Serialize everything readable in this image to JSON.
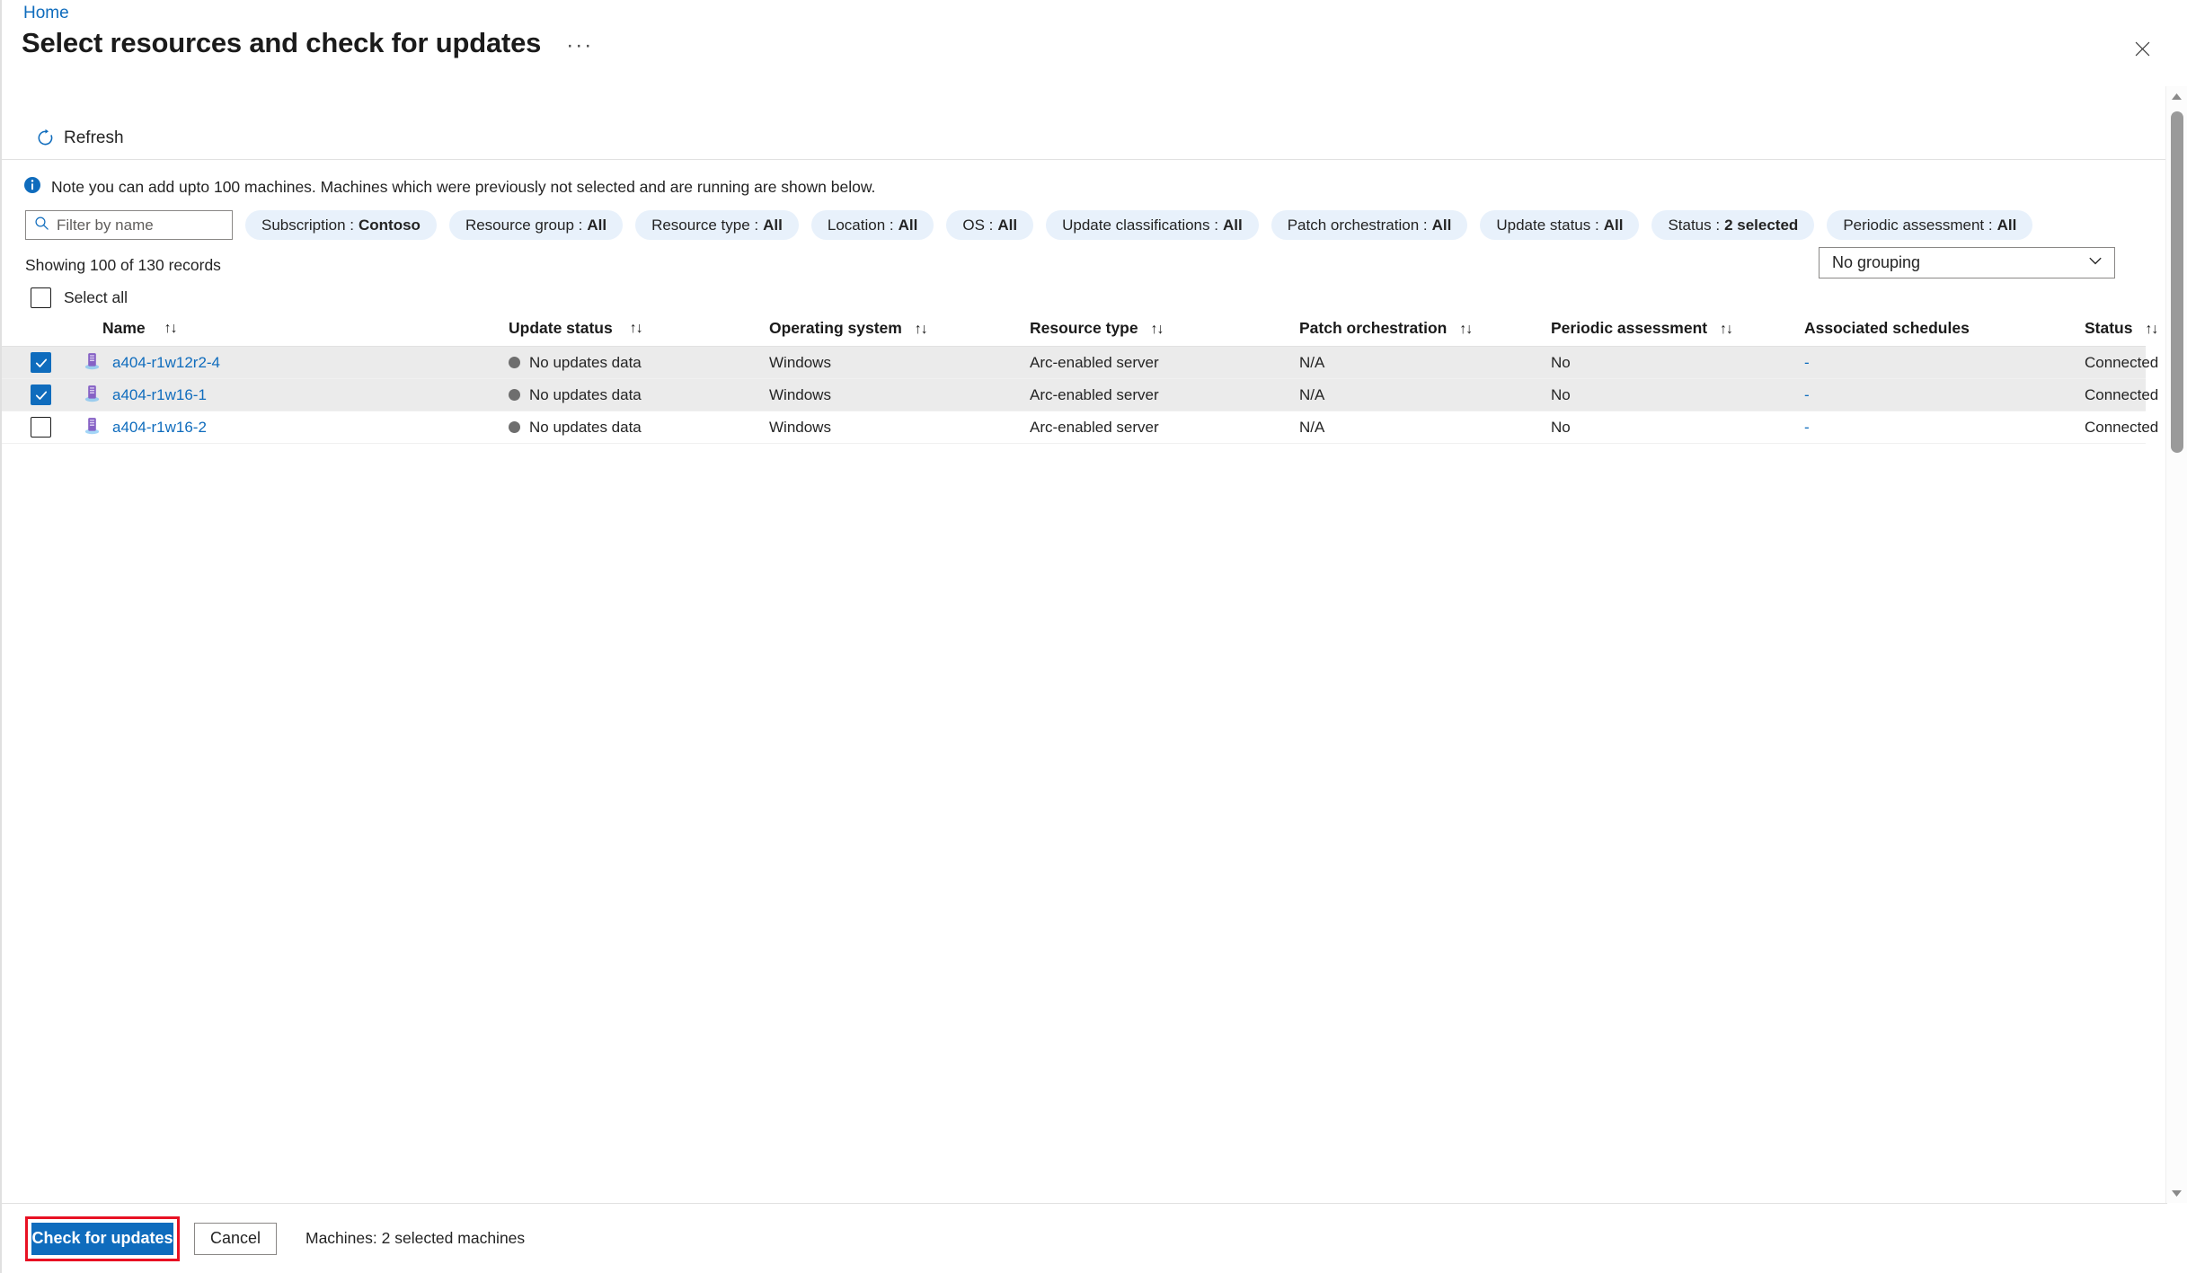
{
  "breadcrumb": {
    "home": "Home"
  },
  "header": {
    "title": "Select resources and check for updates",
    "ellipsis": "···",
    "close_icon": "close-icon"
  },
  "commandbar": {
    "refresh_label": "Refresh",
    "refresh_icon": "refresh-icon"
  },
  "info": {
    "icon": "info-icon",
    "text": "Note you can add upto 100 machines. Machines which were previously not selected and are running are shown below."
  },
  "search": {
    "placeholder": "Filter by name",
    "value": "",
    "icon": "search-icon"
  },
  "filters": [
    {
      "label": "Subscription :",
      "value": "Contoso"
    },
    {
      "label": "Resource group :",
      "value": "All"
    },
    {
      "label": "Resource type :",
      "value": "All"
    },
    {
      "label": "Location :",
      "value": "All"
    },
    {
      "label": "OS :",
      "value": "All"
    },
    {
      "label": "Update classifications :",
      "value": "All"
    },
    {
      "label": "Patch orchestration :",
      "value": "All"
    },
    {
      "label": "Update status :",
      "value": "All"
    },
    {
      "label": "Status :",
      "value": "2 selected"
    },
    {
      "label": "Periodic assessment :",
      "value": "All"
    }
  ],
  "records": {
    "showing_text": "Showing 100 of 130 records"
  },
  "grouping": {
    "selected": "No grouping",
    "chevron_icon": "chevron-down-icon"
  },
  "select_all": {
    "label": "Select all",
    "checked": false
  },
  "table": {
    "columns": [
      {
        "key": "name",
        "label": "Name",
        "sortable": true
      },
      {
        "key": "update_status",
        "label": "Update status",
        "sortable": true
      },
      {
        "key": "operating_system",
        "label": "Operating system",
        "sortable": true
      },
      {
        "key": "resource_type",
        "label": "Resource type",
        "sortable": true
      },
      {
        "key": "patch_orchestration",
        "label": "Patch orchestration",
        "sortable": true
      },
      {
        "key": "periodic_assessment",
        "label": "Periodic assessment",
        "sortable": true
      },
      {
        "key": "associated_schedules",
        "label": "Associated schedules",
        "sortable": false
      },
      {
        "key": "status",
        "label": "Status",
        "sortable": true
      }
    ],
    "sort_glyph": "↑↓",
    "rows": [
      {
        "checked": true,
        "icon": "machine-icon",
        "name": "a404-r1w12r2-4",
        "update_status": "No updates data",
        "operating_system": "Windows",
        "resource_type": "Arc-enabled server",
        "patch_orchestration": "N/A",
        "periodic_assessment": "No",
        "associated_schedules": "-",
        "status": "Connected"
      },
      {
        "checked": true,
        "icon": "machine-icon",
        "name": "a404-r1w16-1",
        "update_status": "No updates data",
        "operating_system": "Windows",
        "resource_type": "Arc-enabled server",
        "patch_orchestration": "N/A",
        "periodic_assessment": "No",
        "associated_schedules": "-",
        "status": "Connected"
      },
      {
        "checked": false,
        "icon": "machine-icon",
        "name": "a404-r1w16-2",
        "update_status": "No updates data",
        "operating_system": "Windows",
        "resource_type": "Arc-enabled server",
        "patch_orchestration": "N/A",
        "periodic_assessment": "No",
        "associated_schedules": "-",
        "status": "Connected"
      }
    ]
  },
  "footer": {
    "primary_label": "Check for updates",
    "secondary_label": "Cancel",
    "note": "Machines: 2 selected machines"
  },
  "colors": {
    "accent": "#0f6cbd",
    "link": "#0f6cbd",
    "pill_bg": "#e8f1fb",
    "row_selected_bg": "#ebebeb",
    "status_dot": "#6e6e6e",
    "highlight_border": "#e81123"
  }
}
